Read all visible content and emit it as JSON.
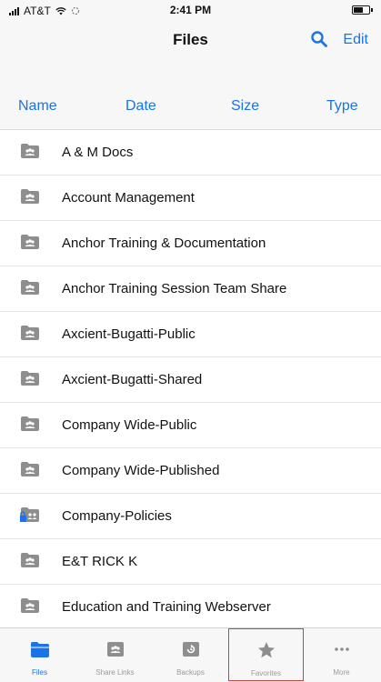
{
  "status_bar": {
    "carrier": "AT&T",
    "time": "2:41 PM"
  },
  "nav_bar": {
    "title": "Files",
    "edit_label": "Edit"
  },
  "sort_bar": {
    "name": "Name",
    "date": "Date",
    "size": "Size",
    "type": "Type"
  },
  "files": [
    {
      "name": "A & M Docs"
    },
    {
      "name": "Account Management"
    },
    {
      "name": "Anchor Training & Documentation"
    },
    {
      "name": "Anchor Training Session Team Share"
    },
    {
      "name": "Axcient-Bugatti-Public"
    },
    {
      "name": "Axcient-Bugatti-Shared"
    },
    {
      "name": "Company Wide-Public"
    },
    {
      "name": "Company Wide-Published"
    },
    {
      "name": "Company-Policies"
    },
    {
      "name": "E&T RICK K"
    },
    {
      "name": "Education and Training Webserver"
    }
  ],
  "tab_bar": {
    "files": "Files",
    "share_links": "Share Links",
    "backups": "Backups",
    "favorites": "Favorites",
    "more": "More"
  },
  "colors": {
    "accent": "#1a73e8",
    "folder_gray": "#8e8e8e",
    "locked_folder_blue": "#1a73e8",
    "highlight_red": "#e53935"
  }
}
